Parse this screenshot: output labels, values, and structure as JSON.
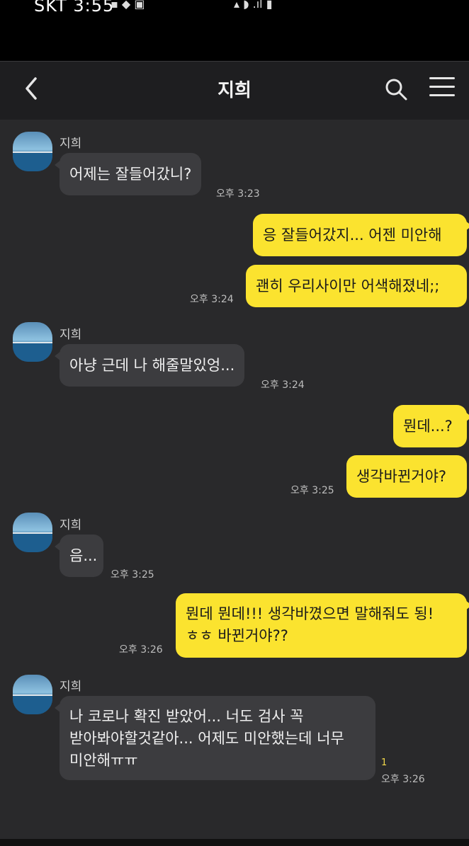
{
  "status_bar": {
    "carrier_time": "SKT 3:55",
    "left_icons": "▪ ◆ ▣",
    "right_icons": "▴ ◗ .ıl ▮"
  },
  "header": {
    "title": "지희",
    "back_icon": "chevron-left-icon",
    "search_icon": "search-icon",
    "menu_icon": "hamburger-menu-icon"
  },
  "messages": [
    {
      "sender": "지희",
      "text": "어제는 잘들어갔니?",
      "time": "오후 3:23",
      "direction": "in"
    },
    {
      "text": "응 잘들어갔지... 어젠 미안해",
      "direction": "out"
    },
    {
      "text": "괜히 우리사이만 어색해졌네;;",
      "time": "오후 3:24",
      "direction": "out"
    },
    {
      "sender": "지희",
      "text": "아냥 근데 나 해줄말있엉...",
      "time": "오후 3:24",
      "direction": "in"
    },
    {
      "text": "뭔데...?",
      "direction": "out"
    },
    {
      "text": "생각바뀐거야?",
      "time": "오후 3:25",
      "direction": "out"
    },
    {
      "sender": "지희",
      "text": "음...",
      "time": "오후 3:25",
      "direction": "in"
    },
    {
      "text_lines": [
        "뭔데 뭔데!!! 생각바꼈으면 말해줘도 됭!",
        "ㅎㅎ 바뀐거야??"
      ],
      "time": "오후 3:26",
      "direction": "out"
    },
    {
      "sender": "지희",
      "text_lines": [
        "나 코로나 확진 받았어... 너도 검사 꼭",
        "받아봐야할것같아... 어제도 미안했는데 너무",
        "미안해ㅠㅠ"
      ],
      "time": "오후 3:26",
      "unread": "1",
      "direction": "in"
    }
  ],
  "colors": {
    "background": "#29292b",
    "incoming_bubble": "#3c3c3f",
    "outgoing_bubble": "#fbe32f",
    "header": "#1e1e20"
  }
}
